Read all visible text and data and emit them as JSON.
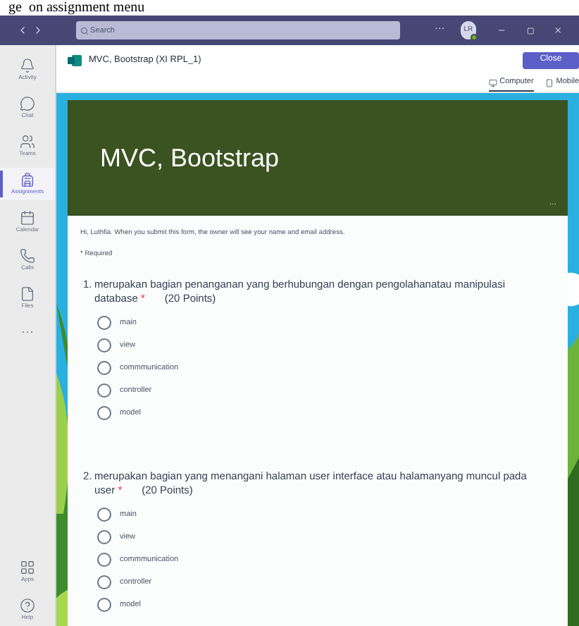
{
  "caption": "ge  on assignment menu",
  "titlebar": {
    "search_placeholder": "Search",
    "more": "···",
    "avatar": "LR"
  },
  "rail": [
    {
      "kind": "activity",
      "label": "Activity",
      "selected": false
    },
    {
      "kind": "chat",
      "label": "Chat",
      "selected": false
    },
    {
      "kind": "teams",
      "label": "Teams",
      "selected": false
    },
    {
      "kind": "assignments",
      "label": "Assignments",
      "selected": true
    },
    {
      "kind": "calendar",
      "label": "Calendar",
      "selected": false
    },
    {
      "kind": "calls",
      "label": "Calls",
      "selected": false
    },
    {
      "kind": "files",
      "label": "Files",
      "selected": false
    },
    {
      "kind": "more",
      "label": "···",
      "selected": false
    }
  ],
  "rail_bottom": [
    {
      "kind": "apps",
      "label": "Apps"
    },
    {
      "kind": "help",
      "label": "Help"
    }
  ],
  "header": {
    "title": "MVC, Bootstrap (XI RPL_1)",
    "close": "Close"
  },
  "view_tabs": [
    {
      "kind": "computer",
      "label": "Computer",
      "selected": true
    },
    {
      "kind": "mobile",
      "label": "Mobile",
      "selected": false
    }
  ],
  "form": {
    "title": "MVC, Bootstrap",
    "more": "...",
    "intro": "Hi, Luthfia. When you submit this form, the owner will see your name and email address.",
    "required": "* Required",
    "questions": [
      {
        "number": "1.",
        "text": "merupakan bagian penanganan yang berhubungan dengan pengolahanatau manipulasi database",
        "mark": "*",
        "points": "(20 Points)",
        "options": [
          {
            "label": "main",
            "selected": false
          },
          {
            "label": "view",
            "selected": false
          },
          {
            "label": "commmunication",
            "selected": false
          },
          {
            "label": "controller",
            "selected": false
          },
          {
            "label": "model",
            "selected": false
          }
        ]
      },
      {
        "number": "2.",
        "text": "merupakan bagian yang menangani halaman user interface atau halamanyang muncul pada user",
        "mark": "*",
        "points": "(20 Points)",
        "options": [
          {
            "label": "main",
            "selected": false
          },
          {
            "label": "view",
            "selected": false
          },
          {
            "label": "commmunication",
            "selected": false
          },
          {
            "label": "controller",
            "selected": false
          },
          {
            "label": "model",
            "selected": false
          }
        ]
      }
    ]
  }
}
